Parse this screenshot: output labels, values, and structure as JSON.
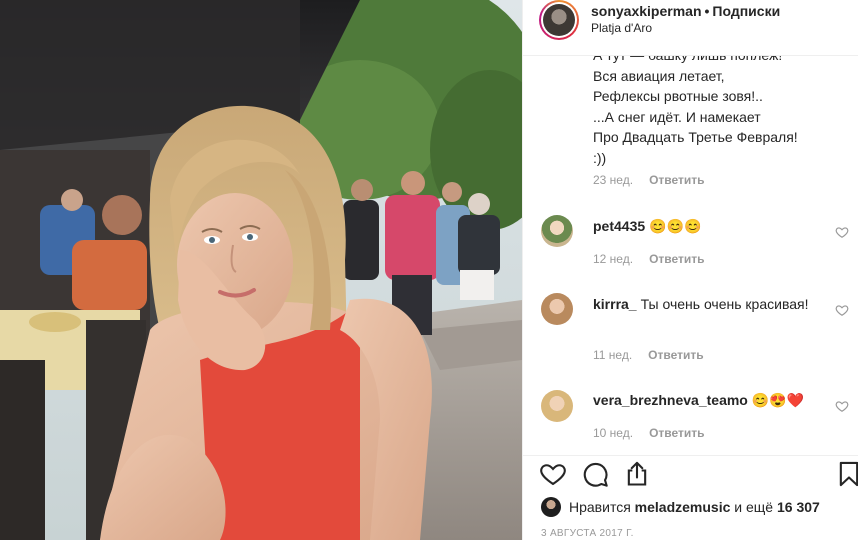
{
  "header": {
    "username": "sonyaxkiperman",
    "separator": "•",
    "follow_state": "Подписки",
    "location": "Platja d'Aro"
  },
  "caption": {
    "text": "А тут — башку лишь поплеж!\nВся авиация летает,\nРефлексы рвотные зовя!..\n...А снег идёт. И намекает\nПро Двадцать Третье Февраля!\n:))",
    "time": "23 нед.",
    "reply_label": "Ответить"
  },
  "comments": [
    {
      "username": "pet4435",
      "text": "😊😊😊",
      "time": "12 нед.",
      "reply_label": "Ответить"
    },
    {
      "username": "kirrra_",
      "text": "Ты очень очень красивая!",
      "time": "11 нед.",
      "reply_label": "Ответить"
    },
    {
      "username": "vera_brezhneva_teamo",
      "text": "😊😍❤️",
      "time": "10 нед.",
      "reply_label": "Ответить"
    }
  ],
  "likes": {
    "prefix": "Нравится",
    "user": "meladzemusic",
    "middle": "и ещё",
    "count": "16 307"
  },
  "date": "3 АВГУСТА 2017 Г.",
  "icons": {
    "like": "heart-icon",
    "comment": "comment-icon",
    "share": "share-icon",
    "save": "bookmark-icon"
  },
  "colors": {
    "text": "#262626",
    "muted": "#999999",
    "border": "#efefef"
  }
}
